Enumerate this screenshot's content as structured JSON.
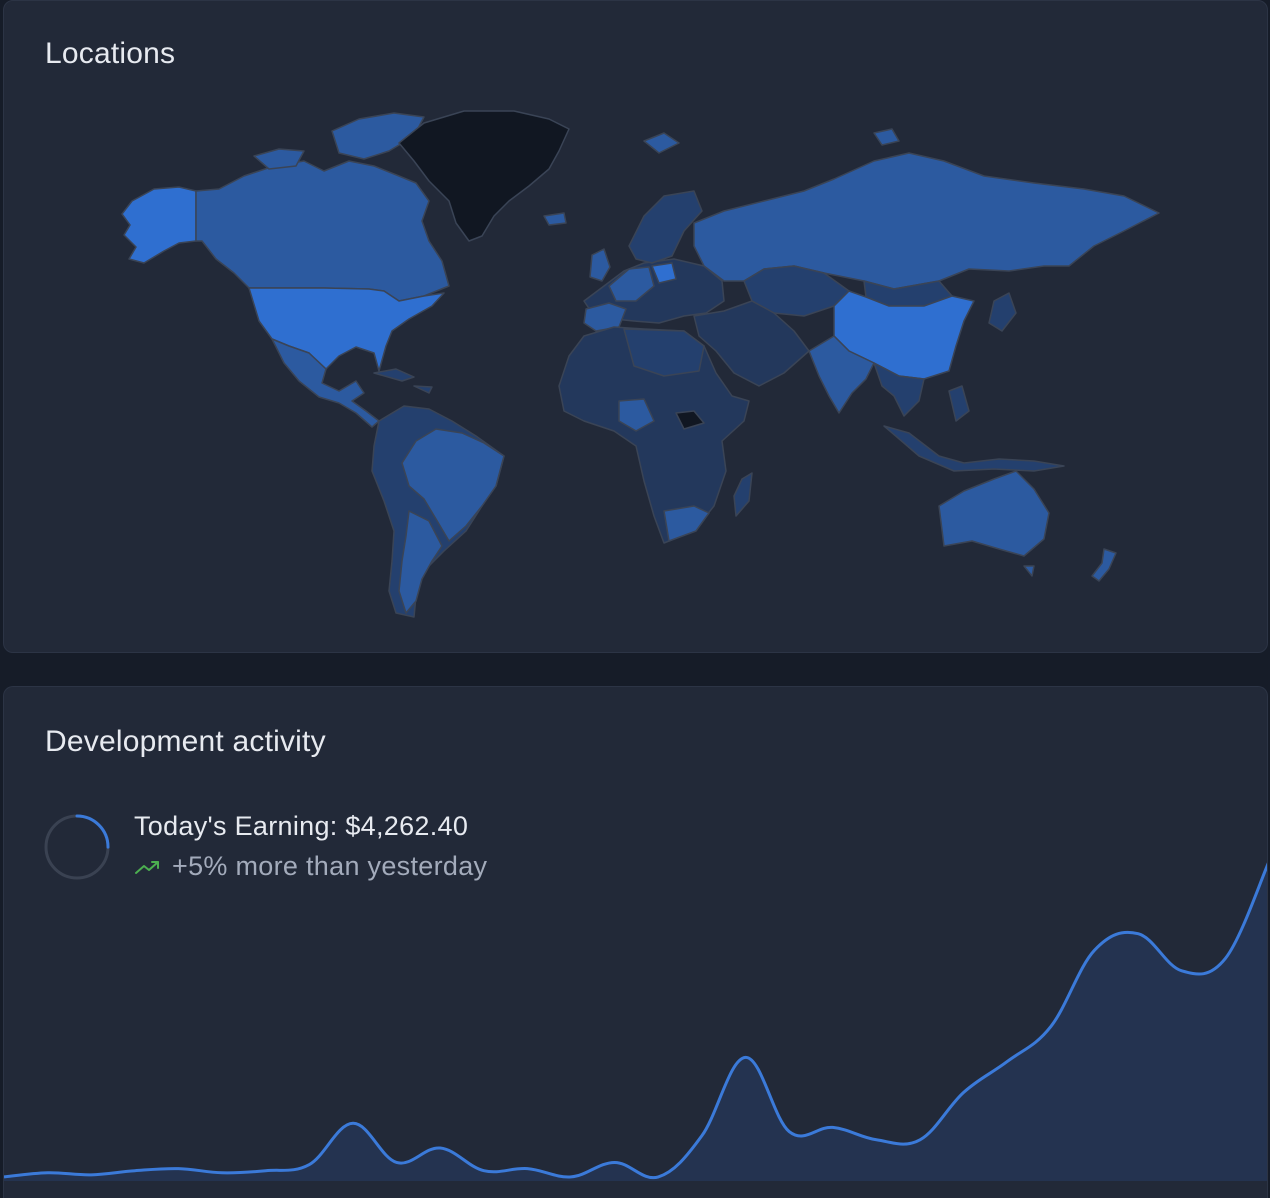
{
  "locations": {
    "title": "Locations",
    "colors": {
      "high": "#2f6fd0",
      "medium": "#2c5aa0",
      "low": "#24406e",
      "lowest": "#23385c",
      "none": "#111722",
      "border": "#3a4456"
    },
    "highlighted_regions": [
      "Alaska",
      "United States",
      "China",
      "Poland"
    ],
    "dark_regions": [
      "Greenland",
      "South Sudan"
    ]
  },
  "activity": {
    "title": "Development activity",
    "earning_text": "Today's Earning: $4,262.40",
    "trend_text": "+5% more than yesterday",
    "trend_icon": "trending-up-icon",
    "progress_fraction": 0.25,
    "colors": {
      "line": "#3b7ad9",
      "fill": "#243350",
      "ring_track": "#3a4252",
      "trend": "#4caf50"
    }
  },
  "chart_data": {
    "type": "area",
    "values": [
      2,
      4,
      3,
      5,
      6,
      4,
      5,
      8,
      28,
      9,
      16,
      5,
      6,
      2,
      9,
      2,
      22,
      60,
      24,
      26,
      20,
      20,
      43,
      58,
      75,
      112,
      120,
      102,
      108,
      155
    ],
    "ylim": [
      0,
      165
    ],
    "grid": false,
    "legend": "none"
  }
}
